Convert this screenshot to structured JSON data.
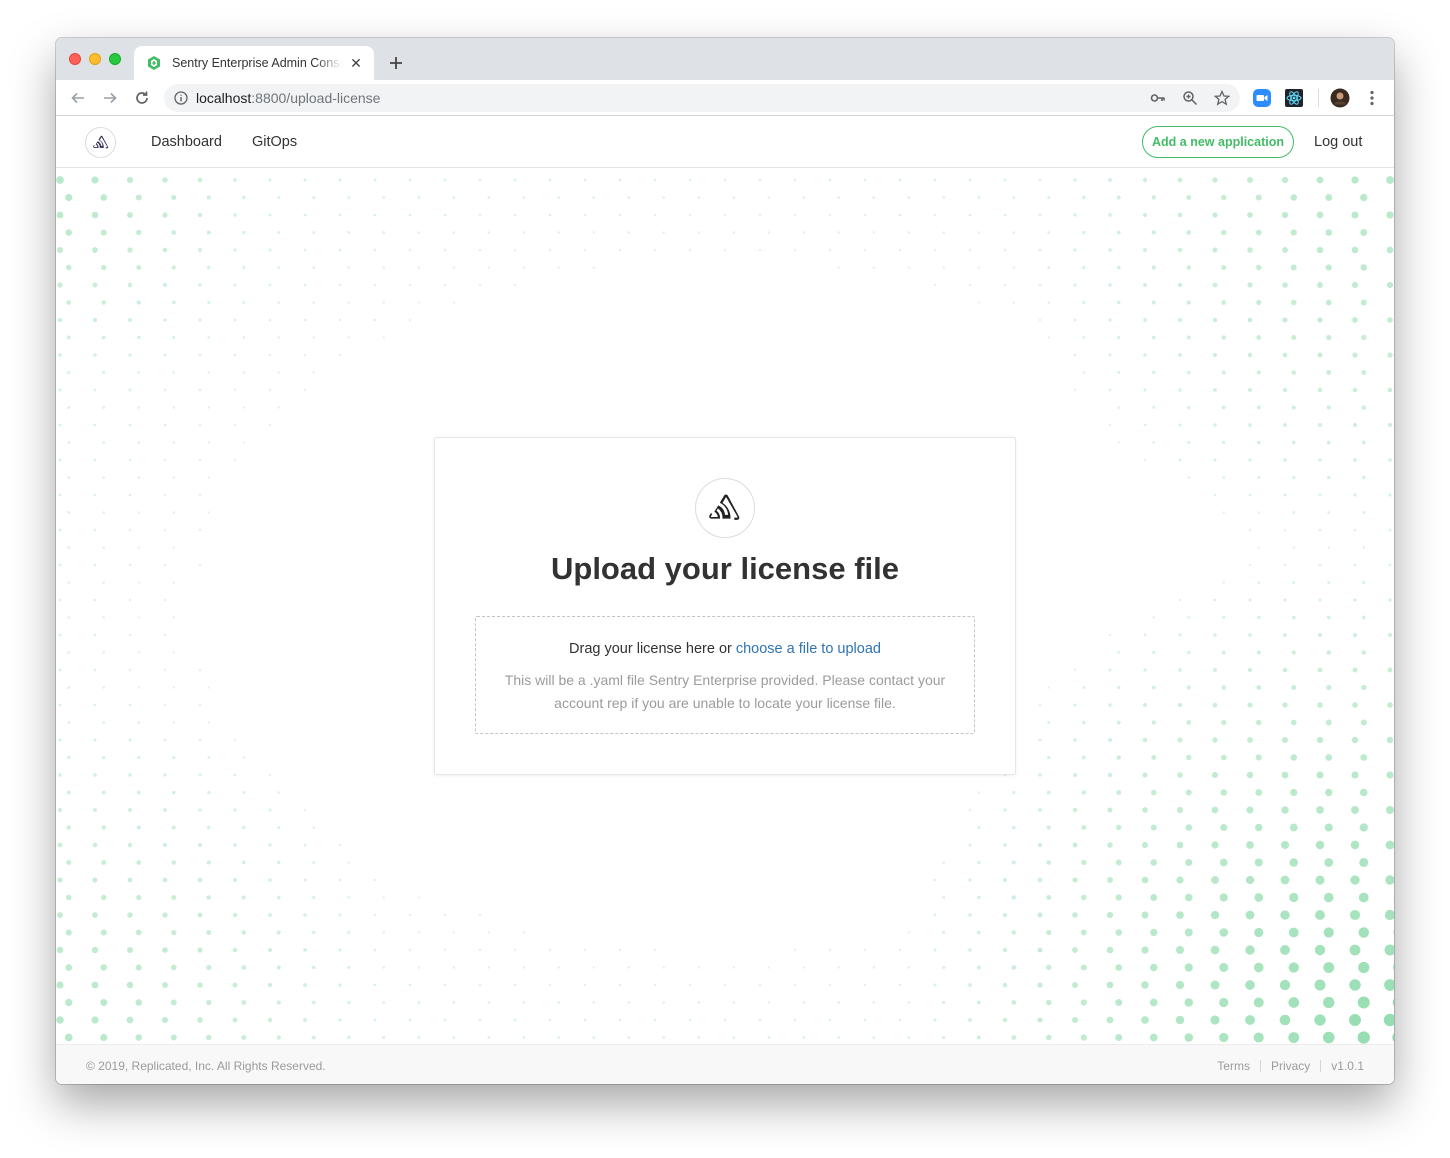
{
  "browser": {
    "tab_title": "Sentry Enterprise Admin Console",
    "new_tab_icon": "plus-icon",
    "url_host": "localhost",
    "url_path": ":8800/upload-license"
  },
  "header": {
    "nav": [
      {
        "label": "Dashboard"
      },
      {
        "label": "GitOps"
      }
    ],
    "add_app_label": "Add a new application",
    "logout_label": "Log out"
  },
  "upload": {
    "title": "Upload your license file",
    "drag_text": "Drag your license here or ",
    "choose_link": "choose a file to upload",
    "help_text": "This will be a .yaml file Sentry Enterprise provided. Please contact your account rep if you are unable to locate your license file."
  },
  "footer": {
    "copyright": "© 2019, Replicated, Inc. All Rights Reserved.",
    "links": [
      "Terms",
      "Privacy",
      "v1.0.1"
    ]
  },
  "colors": {
    "accent_green": "#44bb66",
    "link_blue": "#2f74b5",
    "dot_green": "#7fd6a0"
  }
}
